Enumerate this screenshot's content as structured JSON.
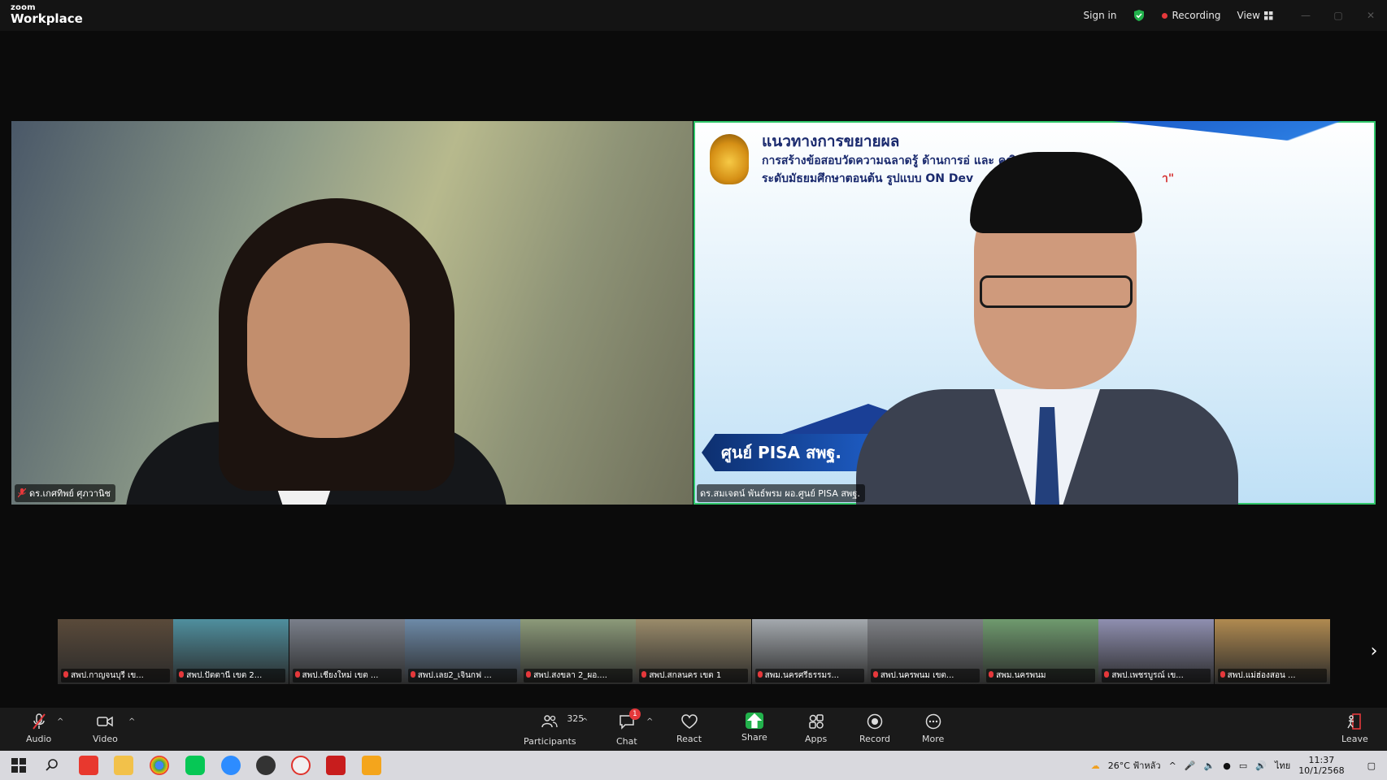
{
  "titlebar": {
    "logo_small": "zoom",
    "logo_big": "Workplace",
    "sign_in": "Sign in",
    "recording": "Recording",
    "view": "View"
  },
  "tiles": [
    {
      "name": "ดร.เกศทิพย์ ศุภวานิช"
    },
    {
      "name": "ดร.สมเจตน์ พันธ์พรม ผอ.ศูนย์ PISA สพฐ."
    }
  ],
  "slide": {
    "title": "แนวทางการขยายผล",
    "line1": "การสร้างข้อสอบวัดความฉลาดรู้ ด้านการอ่               และ คณิตศาสตร์",
    "line2": "ระดับมัธยมศึกษาตอนต้น รูปแบบ ON Dev",
    "quote": "า\"",
    "banner": "ศูนย์ PISA สพฐ."
  },
  "gallery": [
    {
      "label": "สพป.กาญจนบุรี เข...",
      "color": "#5a4a3a"
    },
    {
      "label": "สพป.ปัตตานี เขต 2...",
      "color": "#4f8f9e"
    },
    {
      "label": "สพป.เชียงใหม่ เขต ...",
      "color": "#7a7f8a"
    },
    {
      "label": "สพป.เลย2_เจินกฟ ...",
      "color": "#6d8aa8"
    },
    {
      "label": "สพป.สงขลา 2_ผอ....",
      "color": "#8c9a7a"
    },
    {
      "label": "สพป.สกลนคร เขต 1",
      "color": "#9a8b6a"
    },
    {
      "label": "สพม.นครศรีธรรมร...",
      "color": "#a4a9ae"
    },
    {
      "label": "สพป.นครพนม เขต...",
      "color": "#7d7f84"
    },
    {
      "label": "สพม.นครพนม",
      "color": "#6f9a6e"
    },
    {
      "label": "สพป.เพชรบูรณ์ เข...",
      "color": "#8f8fb0"
    },
    {
      "label": "สพป.แม่ฮ่องสอน ...",
      "color": "#b08a50"
    }
  ],
  "toolbar": {
    "audio": "Audio",
    "video": "Video",
    "participants": "Participants",
    "participants_count": "325",
    "chat": "Chat",
    "chat_badge": "1",
    "react": "React",
    "share": "Share",
    "apps": "Apps",
    "record": "Record",
    "more": "More",
    "leave": "Leave"
  },
  "taskbar": {
    "weather": "26°C ฟ้าหลัว",
    "lang": "ไทย",
    "time": "11:37",
    "date": "10/1/2568"
  },
  "colors": {
    "active_speaker": "#31c76a",
    "share_green": "#22b24c",
    "record_red": "#e5383b"
  }
}
